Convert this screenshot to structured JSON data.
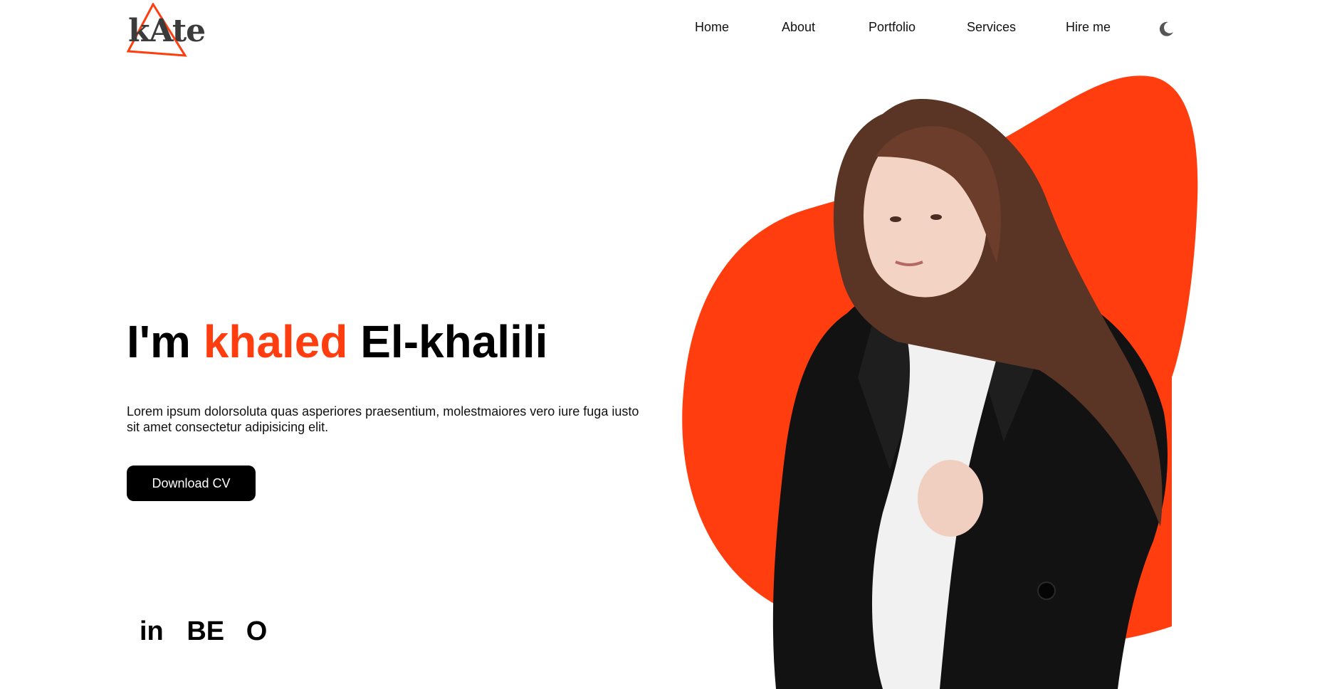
{
  "brand": {
    "logo_text": "kAte",
    "accent_color": "#ff3d0f"
  },
  "nav": {
    "items": [
      "Home",
      "About",
      "Portfolio",
      "Services",
      "Hire me"
    ],
    "theme_toggle_icon": "moon-icon"
  },
  "hero": {
    "title_prefix": "I'm",
    "title_accent": "khaled",
    "title_suffix": "El-khalili",
    "description": "Lorem ipsum dolorsoluta quas asperiores praesentium, molestmaiores vero iure fuga iusto sit amet consectetur adipisicing elit.",
    "cta_label": "Download CV"
  },
  "social": {
    "linkedin": "in",
    "behance": "BE",
    "other": "O"
  }
}
